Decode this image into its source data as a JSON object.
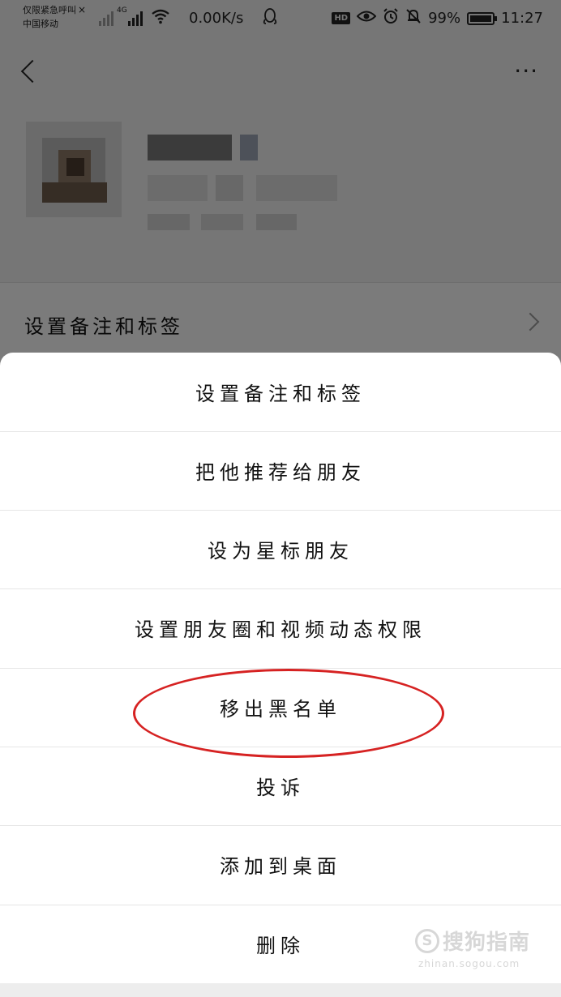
{
  "status_bar": {
    "carrier_line1": "仅限紧急呼叫",
    "carrier_line2": "中国移动",
    "network_type": "4G",
    "speed": "0.00K/s",
    "hd_badge": "HD",
    "battery_level": 0.99,
    "battery": "99%",
    "time": "11:27"
  },
  "contact_settings": {
    "remark_row_label": "设置备注和标签"
  },
  "action_sheet": {
    "items": [
      {
        "label": "设置备注和标签"
      },
      {
        "label": "把他推荐给朋友"
      },
      {
        "label": "设为星标朋友"
      },
      {
        "label": "设置朋友圈和视频动态权限"
      },
      {
        "label": "移出黑名单"
      },
      {
        "label": "投诉"
      },
      {
        "label": "添加到桌面"
      },
      {
        "label": "删除"
      }
    ]
  },
  "annotation": {
    "highlight_color": "#d62222",
    "highlighted_item": "移出黑名单"
  },
  "watermark": {
    "logo": "S",
    "text": "搜狗指南",
    "url": "zhinan.sogou.com"
  }
}
